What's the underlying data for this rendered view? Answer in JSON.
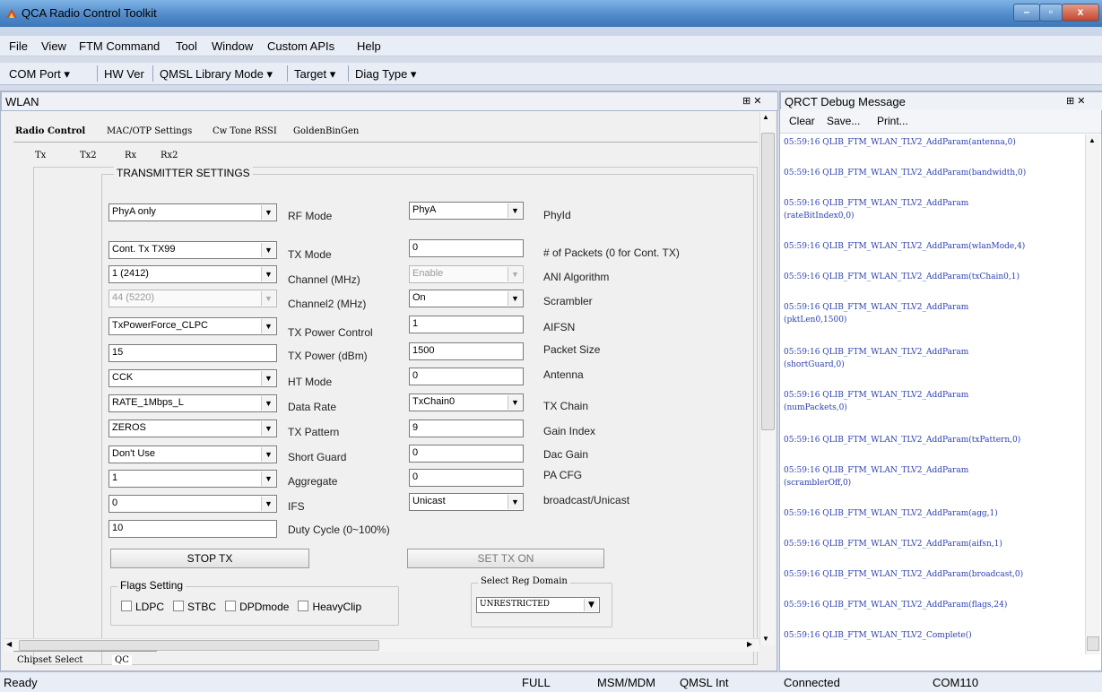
{
  "window": {
    "title": "QCA Radio Control Toolkit",
    "controls": [
      "–",
      "▫",
      "x"
    ]
  },
  "menu": [
    "File",
    "View",
    "FTM Command",
    "Tool",
    "Window",
    "Custom APIs",
    "Help"
  ],
  "toolbar": [
    "COM Port ▾",
    "HW Ver",
    "QMSL Library Mode ▾",
    "Target ▾",
    "Diag Type ▾"
  ],
  "wlan": {
    "title": "WLAN",
    "pin": "⊞ ✕",
    "tabs": [
      "Radio Control",
      "MAC/OTP Settings",
      "Cw Tone RSSI",
      "GoldenBinGen"
    ],
    "subtabs": [
      "Tx",
      "Tx2",
      "Rx",
      "Rx2"
    ],
    "group_title": "TRANSMITTER SETTINGS",
    "left_rows": [
      {
        "value": "PhyA only",
        "label": "RF Mode",
        "dropdown": true,
        "disabled": false
      },
      {
        "value": "Cont. Tx TX99",
        "label": "TX Mode",
        "dropdown": true,
        "disabled": false
      },
      {
        "value": "1 (2412)",
        "label": "Channel (MHz)",
        "dropdown": true,
        "disabled": false
      },
      {
        "value": "44 (5220)",
        "label": "Channel2 (MHz)",
        "dropdown": true,
        "disabled": true
      },
      {
        "value": "TxPowerForce_CLPC",
        "label": "TX Power Control",
        "dropdown": true,
        "disabled": false
      },
      {
        "value": "15",
        "label": "TX Power (dBm)",
        "dropdown": false,
        "disabled": false
      },
      {
        "value": "CCK",
        "label": "HT Mode",
        "dropdown": true,
        "disabled": false
      },
      {
        "value": "RATE_1Mbps_L",
        "label": "Data Rate",
        "dropdown": true,
        "disabled": false
      },
      {
        "value": "ZEROS",
        "label": "TX Pattern",
        "dropdown": true,
        "disabled": false
      },
      {
        "value": "Don't Use",
        "label": "Short Guard",
        "dropdown": true,
        "disabled": false
      },
      {
        "value": "1",
        "label": "Aggregate",
        "dropdown": true,
        "disabled": false
      },
      {
        "value": "0",
        "label": "IFS",
        "dropdown": true,
        "disabled": false
      },
      {
        "value": "10",
        "label": "Duty Cycle (0~100%)",
        "dropdown": false,
        "disabled": false
      }
    ],
    "right_rows": [
      {
        "value": "PhyA",
        "label": "PhyId",
        "dropdown": true,
        "disabled": false
      },
      {
        "value": "0",
        "label": "# of Packets (0 for Cont. TX)",
        "dropdown": false,
        "disabled": false
      },
      {
        "value": "Enable",
        "label": "ANI Algorithm",
        "dropdown": true,
        "disabled": true
      },
      {
        "value": "On",
        "label": "Scrambler",
        "dropdown": true,
        "disabled": false
      },
      {
        "value": "1",
        "label": "AIFSN",
        "dropdown": false,
        "disabled": false
      },
      {
        "value": "1500",
        "label": "Packet Size",
        "dropdown": false,
        "disabled": false
      },
      {
        "value": "0",
        "label": "Antenna",
        "dropdown": false,
        "disabled": false
      },
      {
        "value": "TxChain0",
        "label": "TX Chain",
        "dropdown": true,
        "disabled": false
      },
      {
        "value": "9",
        "label": "Gain Index",
        "dropdown": false,
        "disabled": false
      },
      {
        "value": "0",
        "label": "Dac Gain",
        "dropdown": false,
        "disabled": false
      },
      {
        "value": "0",
        "label": "PA CFG",
        "dropdown": false,
        "disabled": false
      },
      {
        "value": "Unicast",
        "label": "broadcast/Unicast",
        "dropdown": true,
        "disabled": false
      }
    ],
    "stop_tx": "STOP TX",
    "set_tx_on": "SET TX ON",
    "flags": {
      "title": "Flags Setting",
      "items": [
        "LDPC",
        "STBC",
        "DPDmode",
        "HeavyClip"
      ]
    },
    "reg_domain": {
      "title": "Select Reg Domain",
      "value": "UNRESTRICTED"
    },
    "bottom_tabs": [
      "Chipset Select",
      "QC"
    ]
  },
  "debug": {
    "title": "QRCT Debug Message",
    "pin": "⊞ ✕",
    "buttons": [
      "Clear",
      "Save...",
      "Print..."
    ],
    "lines": [
      [
        "05:59:16  QLIB_FTM_WLAN_TLV2_AddParam(antenna,0)"
      ],
      [
        "05:59:16  QLIB_FTM_WLAN_TLV2_AddParam(bandwidth,0)"
      ],
      [
        "05:59:16  QLIB_FTM_WLAN_TLV2_AddParam",
        "(rateBitIndex0,0)"
      ],
      [
        "05:59:16  QLIB_FTM_WLAN_TLV2_AddParam(wlanMode,4)"
      ],
      [
        "05:59:16  QLIB_FTM_WLAN_TLV2_AddParam(txChain0,1)"
      ],
      [
        "05:59:16  QLIB_FTM_WLAN_TLV2_AddParam",
        "(pktLen0,1500)"
      ],
      [
        "05:59:16  QLIB_FTM_WLAN_TLV2_AddParam",
        "(shortGuard,0)"
      ],
      [
        "05:59:16  QLIB_FTM_WLAN_TLV2_AddParam",
        "(numPackets,0)"
      ],
      [
        "05:59:16  QLIB_FTM_WLAN_TLV2_AddParam(txPattern,0)"
      ],
      [
        "05:59:16  QLIB_FTM_WLAN_TLV2_AddParam",
        "(scramblerOff,0)"
      ],
      [
        "05:59:16  QLIB_FTM_WLAN_TLV2_AddParam(agg,1)"
      ],
      [
        "05:59:16  QLIB_FTM_WLAN_TLV2_AddParam(aifsn,1)"
      ],
      [
        "05:59:16  QLIB_FTM_WLAN_TLV2_AddParam(broadcast,0)"
      ],
      [
        "05:59:16  QLIB_FTM_WLAN_TLV2_AddParam(flags,24)"
      ],
      [
        "05:59:16  QLIB_FTM_WLAN_TLV2_Complete()"
      ]
    ]
  },
  "status": {
    "left": "Ready",
    "cells": [
      "FULL",
      "MSM/MDM",
      "QMSL Int",
      "Connected",
      "COM110"
    ]
  }
}
